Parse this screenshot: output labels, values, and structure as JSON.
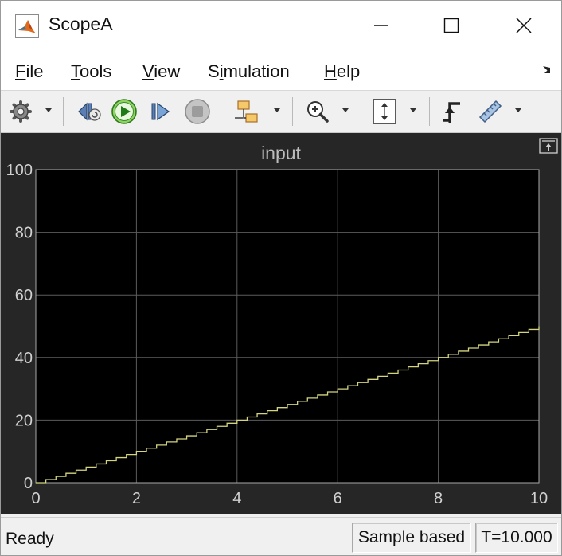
{
  "window": {
    "title": "ScopeA",
    "buttons": [
      "minimize-icon",
      "maximize-icon",
      "close-icon"
    ]
  },
  "menu": {
    "items": [
      {
        "key": "F",
        "rest": "ile"
      },
      {
        "key": "T",
        "rest": "ools"
      },
      {
        "key": "V",
        "rest": "iew"
      },
      {
        "pre": "S",
        "key": "i",
        "rest": "mulation"
      },
      {
        "key": "H",
        "rest": "elp"
      }
    ]
  },
  "toolbar": {
    "icons": [
      "gear-icon",
      "stepback-icon",
      "run-icon",
      "step-forward-icon",
      "stop-icon",
      "highlight-block-icon",
      "zoom-in-icon",
      "autoscale-icon",
      "trigger-icon",
      "measurements-icon"
    ]
  },
  "plot": {
    "title": "input",
    "background": "#000000",
    "line_color": "#d4d480"
  },
  "chart_data": {
    "type": "line",
    "title": "input",
    "xlabel": "",
    "ylabel": "",
    "xlim": [
      0,
      10
    ],
    "ylim": [
      0,
      100
    ],
    "xticks": [
      0,
      2,
      4,
      6,
      8,
      10
    ],
    "yticks": [
      0,
      20,
      40,
      60,
      80,
      100
    ],
    "grid": true,
    "series": [
      {
        "style": "staircase",
        "step": 0.2,
        "x": [
          0,
          0.2,
          0.4,
          0.6,
          0.8,
          1.0,
          1.2,
          1.4,
          1.6,
          1.8,
          2.0,
          2.2,
          2.4,
          2.6,
          2.8,
          3.0,
          3.2,
          3.4,
          3.6,
          3.8,
          4.0,
          4.2,
          4.4,
          4.6,
          4.8,
          5.0,
          5.2,
          5.4,
          5.6,
          5.8,
          6.0,
          6.2,
          6.4,
          6.6,
          6.8,
          7.0,
          7.2,
          7.4,
          7.6,
          7.8,
          8.0,
          8.2,
          8.4,
          8.6,
          8.8,
          9.0,
          9.2,
          9.4,
          9.6,
          9.8,
          10.0
        ],
        "values": [
          0,
          1,
          2,
          3,
          4,
          5,
          6,
          7,
          8,
          9,
          10,
          11,
          12,
          13,
          14,
          15,
          16,
          17,
          18,
          19,
          20,
          21,
          22,
          23,
          24,
          25,
          26,
          27,
          28,
          29,
          30,
          31,
          32,
          33,
          34,
          35,
          36,
          37,
          38,
          39,
          40,
          41,
          42,
          43,
          44,
          45,
          46,
          47,
          48,
          49,
          50
        ]
      }
    ]
  },
  "status": {
    "left": "Ready",
    "mode": "Sample based",
    "time": "T=10.000"
  }
}
